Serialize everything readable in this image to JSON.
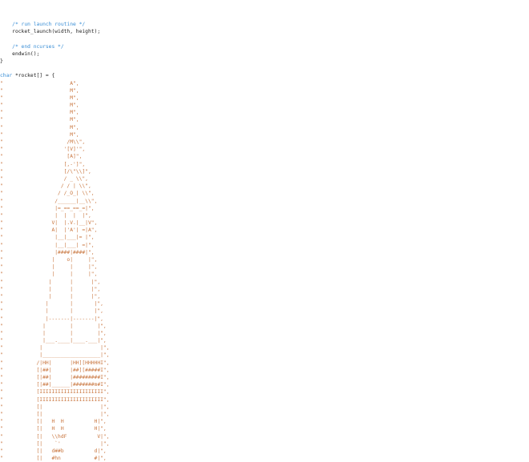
{
  "editor": {
    "lines": [
      [
        {
          "t": "    ",
          "c": "pl"
        },
        {
          "t": "/* run launch routine */",
          "c": "com"
        }
      ],
      [
        {
          "t": "    rocket_launch(width, height);",
          "c": "pl"
        }
      ],
      [],
      [
        {
          "t": "    ",
          "c": "pl"
        },
        {
          "t": "/* end ncurses */",
          "c": "com"
        }
      ],
      [
        {
          "t": "    endwin();",
          "c": "pl"
        }
      ],
      [
        {
          "t": "}",
          "c": "pl"
        }
      ],
      [],
      [
        {
          "t": "char",
          "c": "kw"
        },
        {
          "t": " *rocket[] = {",
          "c": "pl"
        }
      ],
      [
        {
          "t": "\"                      A\",",
          "c": "str"
        }
      ],
      [
        {
          "t": "\"                      M\",",
          "c": "str"
        }
      ],
      [
        {
          "t": "\"                      M\",",
          "c": "str"
        }
      ],
      [
        {
          "t": "\"                      M\",",
          "c": "str"
        }
      ],
      [
        {
          "t": "\"                      M\",",
          "c": "str"
        }
      ],
      [
        {
          "t": "\"                      M\",",
          "c": "str"
        }
      ],
      [
        {
          "t": "\"                      M\",",
          "c": "str"
        }
      ],
      [
        {
          "t": "\"                      M\",",
          "c": "str"
        }
      ],
      [
        {
          "t": "\"                     /M\\\\\",",
          "c": "str"
        }
      ],
      [
        {
          "t": "\"                    '[V]'\",",
          "c": "str"
        }
      ],
      [
        {
          "t": "\"                     [A]\",",
          "c": "str"
        }
      ],
      [
        {
          "t": "\"                    [,-']\",",
          "c": "str"
        }
      ],
      [
        {
          "t": "\"                    [/\\\"\\\\]\",",
          "c": "str"
        }
      ],
      [
        {
          "t": "\"                    / _ \\\\\",",
          "c": "str"
        }
      ],
      [
        {
          "t": "\"                   / / | \\\\\",",
          "c": "str"
        }
      ],
      [
        {
          "t": "\"                  / /_O_| \\\\\",",
          "c": "str"
        }
      ],
      [
        {
          "t": "\"                 /______|__\\\\\",",
          "c": "str"
        }
      ],
      [
        {
          "t": "\"                 |=_==_==_=|\",",
          "c": "str"
        }
      ],
      [
        {
          "t": "\"                 |  |  |  |\",",
          "c": "str"
        }
      ],
      [
        {
          "t": "\"                V|  |.V.|__|V\",",
          "c": "str"
        }
      ],
      [
        {
          "t": "\"                A|  |'A'| =|A\",",
          "c": "str"
        }
      ],
      [
        {
          "t": "\"                 |__|___|= |\",",
          "c": "str"
        }
      ],
      [
        {
          "t": "\"                 |__|___| =|\",",
          "c": "str"
        }
      ],
      [
        {
          "t": "\"                 |####|####|\",",
          "c": "str"
        }
      ],
      [
        {
          "t": "\"                |    o|     |\",",
          "c": "str"
        }
      ],
      [
        {
          "t": "\"                |     |     |\",",
          "c": "str"
        }
      ],
      [
        {
          "t": "\"                |     |     |\",",
          "c": "str"
        }
      ],
      [
        {
          "t": "\"               |      |      |\",",
          "c": "str"
        }
      ],
      [
        {
          "t": "\"               |      |      |\",",
          "c": "str"
        }
      ],
      [
        {
          "t": "\"               |      |      |\",",
          "c": "str"
        }
      ],
      [
        {
          "t": "\"              |       |       |\",",
          "c": "str"
        }
      ],
      [
        {
          "t": "\"              |       |       |\",",
          "c": "str"
        }
      ],
      [
        {
          "t": "\"              |-------|-------|\",",
          "c": "str"
        }
      ],
      [
        {
          "t": "\"             |        |        |\",",
          "c": "str"
        }
      ],
      [
        {
          "t": "\"             |        |        |\",",
          "c": "str"
        }
      ],
      [
        {
          "t": "\"             |___.____|____.___|\",",
          "c": "str"
        }
      ],
      [
        {
          "t": "\"            |                   |\",",
          "c": "str"
        }
      ],
      [
        {
          "t": "\"            |___________________|\",",
          "c": "str"
        }
      ],
      [
        {
          "t": "\"           /|HH|      |HH][HHHHHI\",",
          "c": "str"
        }
      ],
      [
        {
          "t": "\"           [|##|      |##][#####I\",",
          "c": "str"
        }
      ],
      [
        {
          "t": "\"           [|##|      |#########I\",",
          "c": "str"
        }
      ],
      [
        {
          "t": "\"           [|##|______|#######m#I\",",
          "c": "str"
        }
      ],
      [
        {
          "t": "\"           [IIIIIIIIIIIIIIIIIIIII\",",
          "c": "str"
        }
      ],
      [
        {
          "t": "\"           [IIIIIIIIIIIIIIIIIIIII\",",
          "c": "str"
        }
      ],
      [
        {
          "t": "\"           [|                   |\",",
          "c": "str"
        }
      ],
      [
        {
          "t": "\"           [|                   |\",",
          "c": "str"
        }
      ],
      [
        {
          "t": "\"           [|   H  H          H|\",",
          "c": "str"
        }
      ],
      [
        {
          "t": "\"           [|   H  H          H|\",",
          "c": "str"
        }
      ],
      [
        {
          "t": "\"           [|   \\\\hdF          V|\",",
          "c": "str"
        }
      ],
      [
        {
          "t": "\"           [|    `'             |\",",
          "c": "str"
        }
      ],
      [
        {
          "t": "\"           [|   d##b          d|\",",
          "c": "str"
        }
      ],
      [
        {
          "t": "\"           [|   #hn           #|\",",
          "c": "str"
        }
      ]
    ]
  }
}
